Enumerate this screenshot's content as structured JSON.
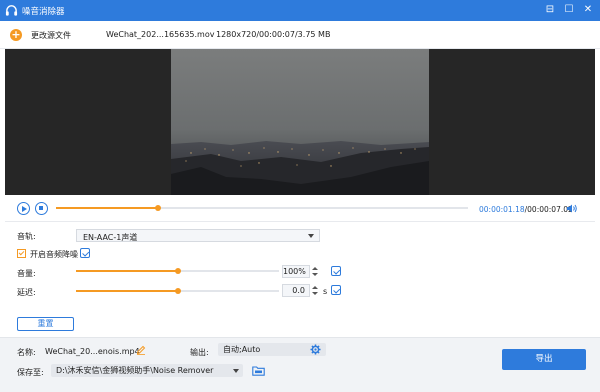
{
  "titlebar": {
    "title": "噪音消除器",
    "minimize_glyph": "⊟",
    "maximize_glyph": "☐",
    "close_glyph": "✕"
  },
  "filebar": {
    "add_source_label": "更改源文件",
    "add_icon": "+",
    "file_name": "WeChat_202...165635.mov",
    "file_meta": "1280x720/00:00:07/3.75 MB"
  },
  "playback": {
    "current_time": "00:00:01.18",
    "separator": "/",
    "total_time": "00:00:07.02",
    "progress_fraction": 0.247
  },
  "settings": {
    "track_label": "音轨:",
    "track_value": "EN-AAC-1声道",
    "noise_label": "开启音频降噪",
    "noise_enabled": true,
    "volume_label": "音量:",
    "volume_value": "100%",
    "volume_fraction": 0.5,
    "delay_label": "延迟:",
    "delay_value": "0.0",
    "delay_unit": "s",
    "delay_fraction": 0.5,
    "reset_label": "重置"
  },
  "output": {
    "name_label": "名称:",
    "name_value": "WeChat_20...enois.mp4",
    "output_label": "输出:",
    "output_value": "自动;Auto",
    "save_label": "保存至:",
    "save_path": "D:\\沐禾安信\\金狮视频助手\\Noise Remover",
    "export_label": "导出"
  },
  "colors": {
    "accent_blue": "#2e7bdc",
    "accent_orange": "#f59a23"
  }
}
